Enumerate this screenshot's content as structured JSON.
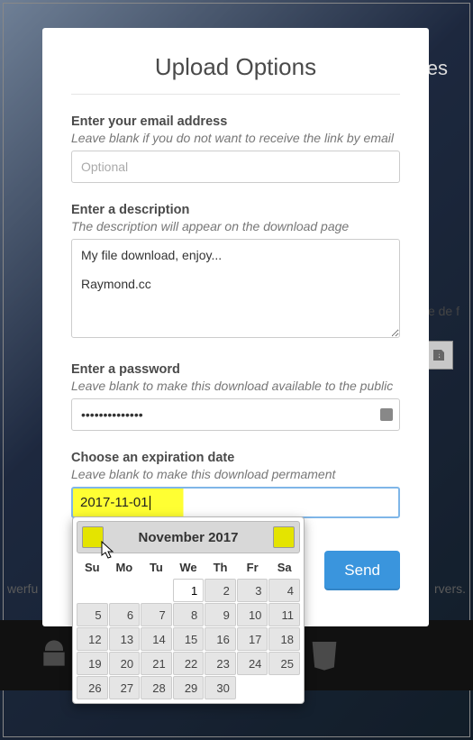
{
  "bg": {
    "top_partial": "es",
    "left_partial": "werfu",
    "right_partial": "rvers.",
    "mid_partial": "pe de f"
  },
  "modal": {
    "title": "Upload Options",
    "email": {
      "label": "Enter your email address",
      "hint": "Leave blank if you do not want to receive the link by email",
      "placeholder": "Optional",
      "value": ""
    },
    "description": {
      "label": "Enter a description",
      "hint": "The description will appear on the download page",
      "value": "My file download, enjoy...\n\nRaymond.cc"
    },
    "password": {
      "label": "Enter a password",
      "hint": "Leave blank to make this download available to the public",
      "value": "••••••••••••••"
    },
    "expiration": {
      "label": "Choose an expiration date",
      "hint": "Leave blank to make this download permament",
      "value": "2017-11-01"
    },
    "send": "Send"
  },
  "datepicker": {
    "title": "November 2017",
    "dow": [
      "Su",
      "Mo",
      "Tu",
      "We",
      "Th",
      "Fr",
      "Sa"
    ],
    "leading_blanks": 3,
    "days": 30,
    "active_day": 1
  }
}
